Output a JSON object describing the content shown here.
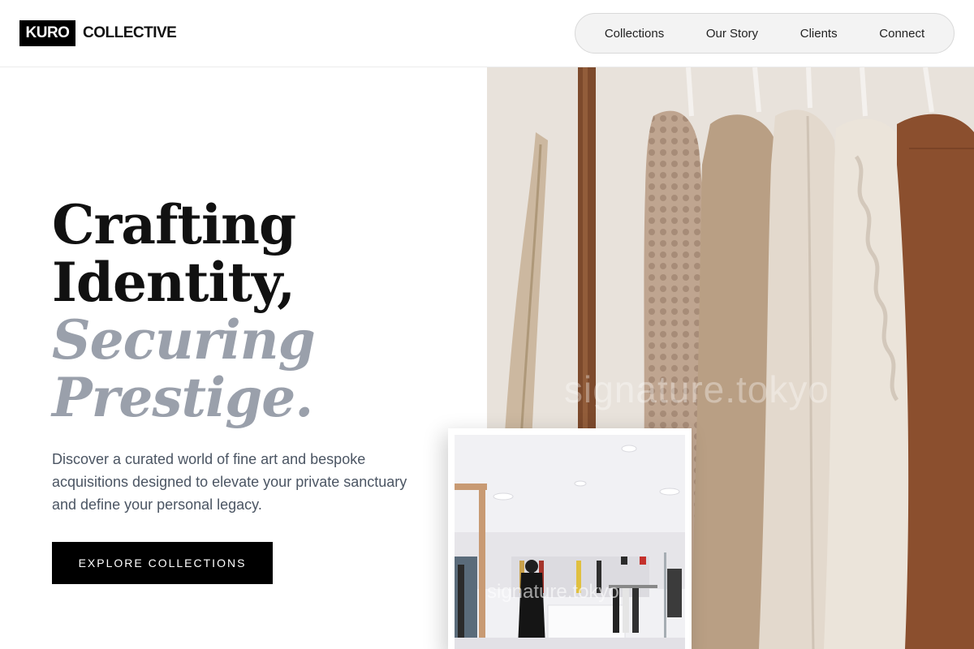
{
  "brand": {
    "logo_box": "KURO",
    "logo_text": "COLLECTIVE"
  },
  "nav": {
    "items": [
      "Collections",
      "Our Story",
      "Clients",
      "Connect"
    ]
  },
  "hero": {
    "title_lines": [
      "Crafting",
      "Identity,",
      "Securing",
      "Prestige."
    ],
    "subtitle": "Discover a curated world of fine art and bespoke acquisitions designed to elevate your private sanctuary and define your personal legacy.",
    "cta": "EXPLORE COLLECTIONS"
  },
  "images": {
    "main_watermark": "signature.tokyo",
    "inset_watermark": "signature.tokyo"
  },
  "colors": {
    "accent_grey": "#9aa0ab",
    "black": "#000000",
    "body_text": "#4b5563"
  }
}
